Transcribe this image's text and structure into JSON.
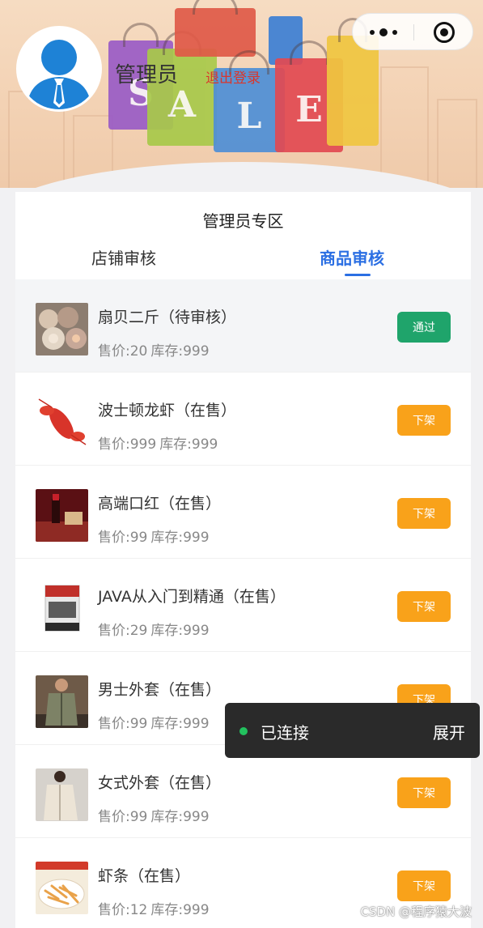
{
  "header": {
    "admin_name": "管理员",
    "logout_label": "退出登录",
    "banner_letters": [
      "S",
      "A",
      "L",
      "E"
    ]
  },
  "capsule": {
    "more_icon": "more-dots-icon",
    "close_icon": "target-icon"
  },
  "panel": {
    "title": "管理员专区",
    "tabs": [
      {
        "label": "店铺审核",
        "active": false
      },
      {
        "label": "商品审核",
        "active": true
      }
    ]
  },
  "products": [
    {
      "title": "扇贝二斤（待审核）",
      "price_label": "售价:20",
      "stock_label": "库存:999",
      "action": "通过",
      "status": "pending",
      "thumb": "scallop-image"
    },
    {
      "title": "波士顿龙虾（在售）",
      "price_label": "售价:999",
      "stock_label": "库存:999",
      "action": "下架",
      "status": "on-sale",
      "thumb": "lobster-image"
    },
    {
      "title": "高端口红（在售）",
      "price_label": "售价:99",
      "stock_label": "库存:999",
      "action": "下架",
      "status": "on-sale",
      "thumb": "lipstick-image"
    },
    {
      "title": "JAVA从入门到精通（在售）",
      "price_label": "售价:29",
      "stock_label": "库存:999",
      "action": "下架",
      "status": "on-sale",
      "thumb": "book-image"
    },
    {
      "title": "男士外套（在售）",
      "price_label": "售价:99",
      "stock_label": "库存:999",
      "action": "下架",
      "status": "on-sale",
      "thumb": "mens-coat-image"
    },
    {
      "title": "女式外套（在售）",
      "price_label": "售价:99",
      "stock_label": "库存:999",
      "action": "下架",
      "status": "on-sale",
      "thumb": "womens-coat-image"
    },
    {
      "title": "虾条（在售）",
      "price_label": "售价:12",
      "stock_label": "库存:999",
      "action": "下架",
      "status": "on-sale",
      "thumb": "shrimp-chips-image"
    }
  ],
  "toast": {
    "status_text": "已连接",
    "expand_label": "展开",
    "status_color": "#22c15e"
  },
  "watermark": "CSDN @程序猿大波",
  "colors": {
    "accent": "#2b6fe3",
    "approve": "#1fa46b",
    "offline": "#f9a21a",
    "logout": "#d9362b"
  }
}
